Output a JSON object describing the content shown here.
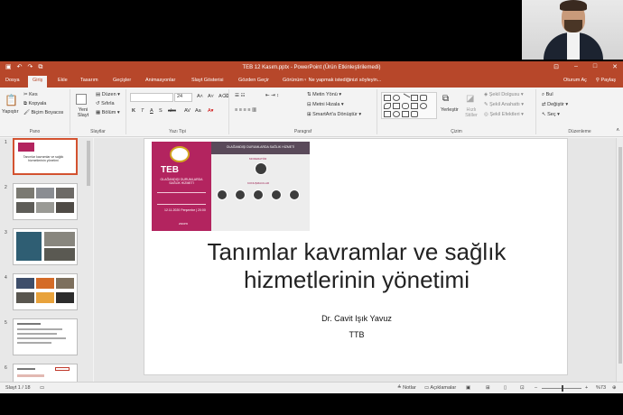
{
  "window": {
    "title": "TEB 12 Kasım.pptx - PowerPoint (Ürün Etkinleştirilemedi)",
    "qat": [
      "save-icon",
      "undo-icon",
      "redo-icon",
      "present-icon"
    ]
  },
  "tabs": {
    "items": [
      "Dosya",
      "Giriş",
      "Ekle",
      "Tasarım",
      "Geçişler",
      "Animasyonlar",
      "Slayt Gösterisi",
      "Gözden Geçir",
      "Görünüm"
    ],
    "active": "Giriş",
    "tell_me": "Ne yapmak istediğinizi söyleyin...",
    "signin": "Oturum Aç",
    "share": "Paylaş"
  },
  "ribbon": {
    "clipboard": {
      "paste": "Yapıştır",
      "cut": "Kes",
      "copy": "Kopyala",
      "format_painter": "Biçim Boyacısı",
      "group": "Pano"
    },
    "slides": {
      "new_slide": "Yeni Slayt",
      "layout": "Düzen",
      "reset": "Sıfırla",
      "section": "Bölüm",
      "group": "Slaytlar"
    },
    "font": {
      "font_name": "",
      "font_size": "24",
      "bold": "K",
      "italic": "T",
      "underline": "A",
      "strike": "S",
      "spacing": "abc",
      "group": "Yazı Tipi"
    },
    "paragraph": {
      "text_direction": "Metin Yönü",
      "align_text": "Metni Hizala",
      "smartart": "SmartArt'a Dönüştür",
      "group": "Paragraf"
    },
    "drawing": {
      "arrange": "Yerleştir",
      "quick_styles": "Hızlı Stiller",
      "shape_fill": "Şekil Dolgusu",
      "shape_outline": "Şekil Anahattı",
      "shape_effects": "Şekil Efektleri",
      "group": "Çizim"
    },
    "editing": {
      "find": "Bul",
      "replace": "Değiştir",
      "select": "Seç",
      "group": "Düzenleme"
    }
  },
  "thumbnails": [
    {
      "num": "1",
      "text": "Tanımlar kavramlar ve sağlık hizmetlerinin yönetimi"
    },
    {
      "num": "2",
      "text": ""
    },
    {
      "num": "3",
      "text": ""
    },
    {
      "num": "4",
      "text": ""
    },
    {
      "num": "5",
      "text": ""
    },
    {
      "num": "6",
      "text": ""
    }
  ],
  "slide": {
    "poster": {
      "brand": "TEB",
      "headline": "OLAĞANDIŞI DURUMLARDA SAĞLIK HİZMETİ",
      "subtitle": "OLAĞANDIŞI DURUMLARDA SAĞLIK HİZMETİ",
      "date": "12.11.2020 Perşembe | 20:00",
      "platform": "zoom",
      "moderator_label": "MODERATÖR",
      "speakers_label": "KONUŞMACILAR"
    },
    "title": "Tanımlar kavramlar ve sağlık hizmetlerinin yönetimi",
    "author": "Dr. Cavit Işık Yavuz",
    "org": "TTB"
  },
  "status": {
    "slide_counter": "Slayt 1 / 18",
    "notes": "Notlar",
    "comments": "Açıklamalar",
    "zoom": "%73"
  }
}
